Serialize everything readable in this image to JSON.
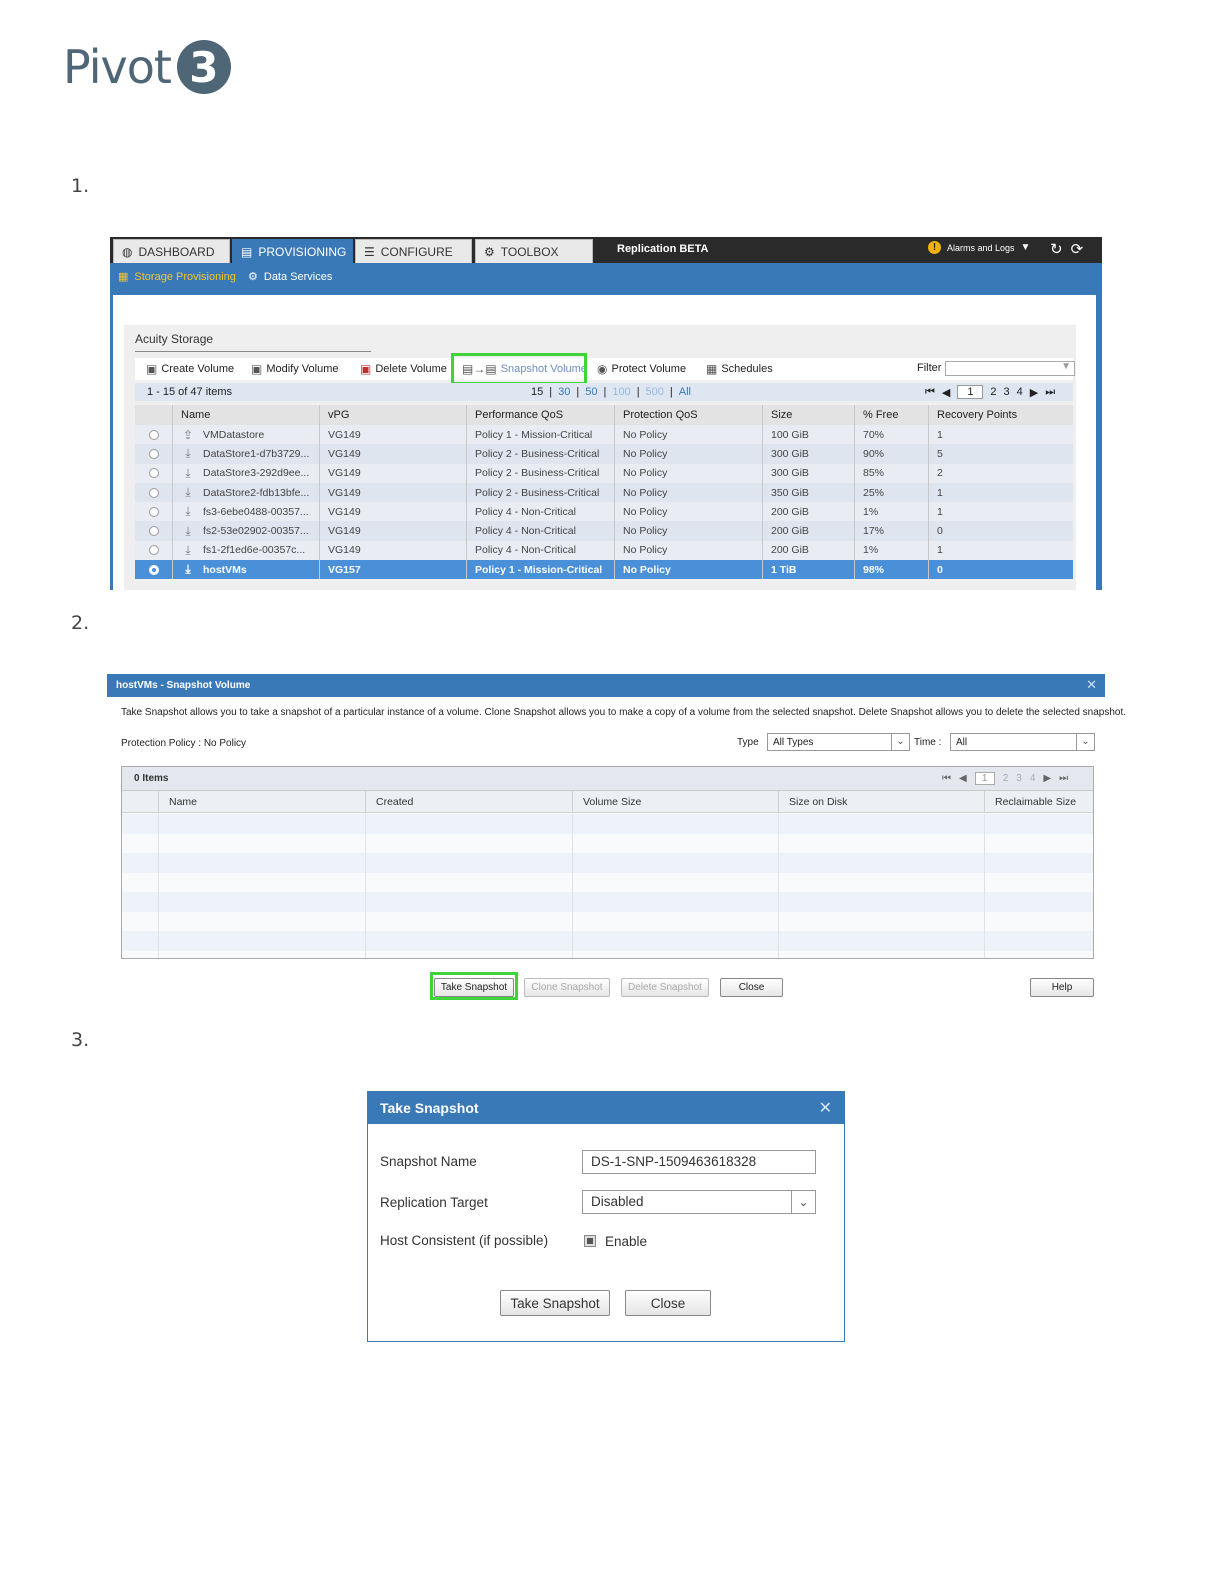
{
  "logo": {
    "text": "Pivot",
    "circle": "3"
  },
  "steps": [
    "1.",
    "2.",
    "3."
  ],
  "shot1": {
    "tabs": [
      {
        "label": "DASHBOARD",
        "icon": "dashboard-icon"
      },
      {
        "label": "PROVISIONING",
        "icon": "provisioning-icon"
      },
      {
        "label": "CONFIGURE",
        "icon": "configure-icon"
      },
      {
        "label": "TOOLBOX",
        "icon": "toolbox-icon"
      }
    ],
    "replication": "Replication BETA",
    "alarms": "Alarms and Logs",
    "sub": {
      "storage": "Storage Provisioning",
      "data": "Data Services"
    },
    "panel_title": "Acuity Storage",
    "toolbar": {
      "create": "Create Volume",
      "modify": "Modify Volume",
      "delete": "Delete Volume",
      "snapshot": "Snapshot Volume",
      "protect": "Protect Volume",
      "schedules": "Schedules",
      "filter": "Filter"
    },
    "pager": {
      "items": "1 - 15 of 47 items",
      "sizes": [
        "15",
        "30",
        "50",
        "100",
        "500",
        "All"
      ],
      "pages": [
        "1",
        "2",
        "3",
        "4"
      ]
    },
    "columns": [
      "Name",
      "vPG",
      "Performance QoS",
      "Protection QoS",
      "Size",
      "% Free",
      "Recovery Points"
    ],
    "rows": [
      [
        "VMDatastore",
        "VG149",
        "Policy 1 - Mission-Critical",
        "No Policy",
        "100 GiB",
        "70%",
        "1"
      ],
      [
        "DataStore1-d7b3729...",
        "VG149",
        "Policy 2 - Business-Critical",
        "No Policy",
        "300 GiB",
        "90%",
        "5"
      ],
      [
        "DataStore3-292d9ee...",
        "VG149",
        "Policy 2 - Business-Critical",
        "No Policy",
        "300 GiB",
        "85%",
        "2"
      ],
      [
        "DataStore2-fdb13bfe...",
        "VG149",
        "Policy 2 - Business-Critical",
        "No Policy",
        "350 GiB",
        "25%",
        "1"
      ],
      [
        "fs3-6ebe0488-00357...",
        "VG149",
        "Policy 4 - Non-Critical",
        "No Policy",
        "200 GiB",
        "1%",
        "1"
      ],
      [
        "fs2-53e02902-00357...",
        "VG149",
        "Policy 4 - Non-Critical",
        "No Policy",
        "200 GiB",
        "17%",
        "0"
      ],
      [
        "fs1-2f1ed6e-00357c...",
        "VG149",
        "Policy 4 - Non-Critical",
        "No Policy",
        "200 GiB",
        "1%",
        "1"
      ],
      [
        "hostVMs",
        "VG157",
        "Policy 1 - Mission-Critical",
        "No Policy",
        "1 TiB",
        "98%",
        "0"
      ]
    ]
  },
  "shot2": {
    "title": "hostVMs - Snapshot Volume",
    "description": "Take Snapshot allows you to take a snapshot of a particular instance of a volume. Clone Snapshot allows you to make a copy of a volume from the selected snapshot. Delete Snapshot allows you to delete the selected snapshot.",
    "protection": "Protection Policy : No Policy",
    "type_label": "Type",
    "type_value": "All Types",
    "time_label": "Time :",
    "time_value": "All",
    "items": "0 Items",
    "pages": [
      "1",
      "2",
      "3",
      "4"
    ],
    "columns": [
      "Name",
      "Created",
      "Volume Size",
      "Size on Disk",
      "Reclaimable Size"
    ],
    "buttons": {
      "take": "Take Snapshot",
      "clone": "Clone Snapshot",
      "delete": "Delete Snapshot",
      "close": "Close",
      "help": "Help"
    }
  },
  "shot3": {
    "title": "Take Snapshot",
    "fields": {
      "name_label": "Snapshot Name",
      "name_value": "DS-1-SNP-1509463618328",
      "target_label": "Replication Target",
      "target_value": "Disabled",
      "host_label": "Host Consistent (if possible)",
      "enable_label": "Enable"
    },
    "buttons": {
      "take": "Take Snapshot",
      "close": "Close"
    }
  }
}
